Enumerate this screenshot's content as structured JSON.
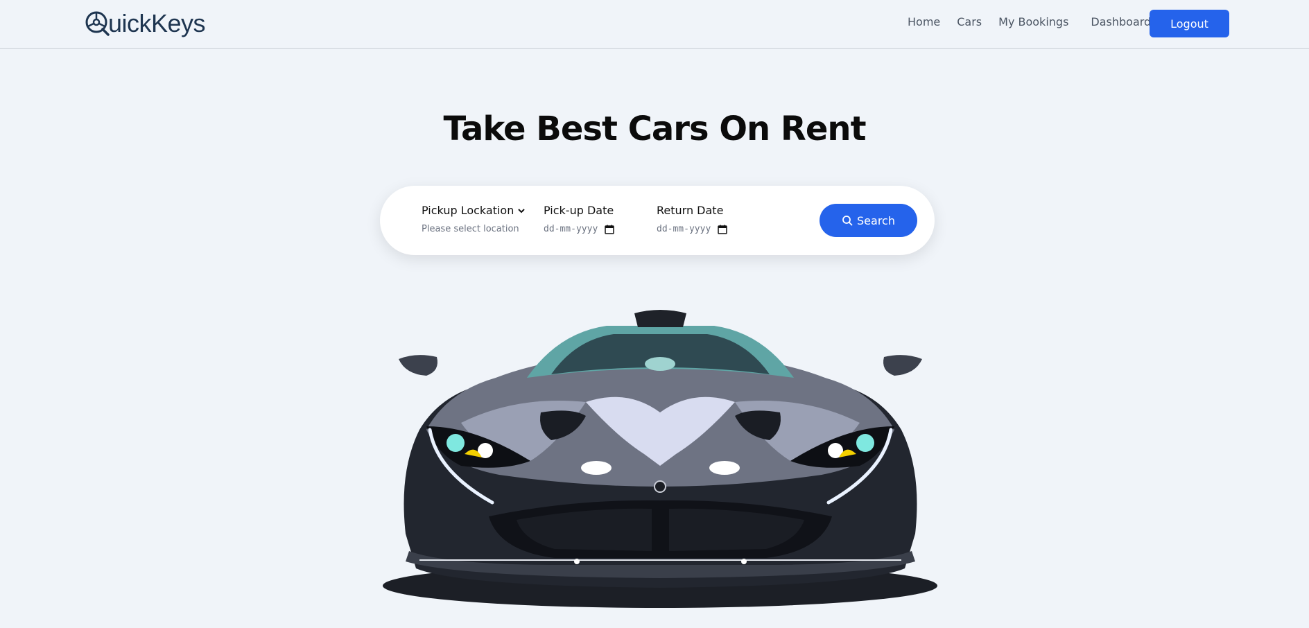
{
  "app": {
    "logo_text": "uickKeys",
    "logo_icon": "steering-wheel-q-icon"
  },
  "nav": {
    "home": "Home",
    "cars": "Cars",
    "bookings": "My Bookings",
    "dashboard": "Dashboard",
    "logout": "Logout"
  },
  "hero": {
    "title": "Take Best Cars On Rent"
  },
  "search": {
    "location_label": "Pickup Lockation",
    "location_placeholder": "Please select location",
    "pickup_label": "Pick-up Date",
    "pickup_placeholder": "dd-mm-yyyy",
    "return_label": "Return Date",
    "return_placeholder": "dd-mm-yyyy",
    "button": "Search"
  },
  "colors": {
    "accent": "#2563eb",
    "background": "#f0f4f9",
    "logo": "#1e3550"
  }
}
